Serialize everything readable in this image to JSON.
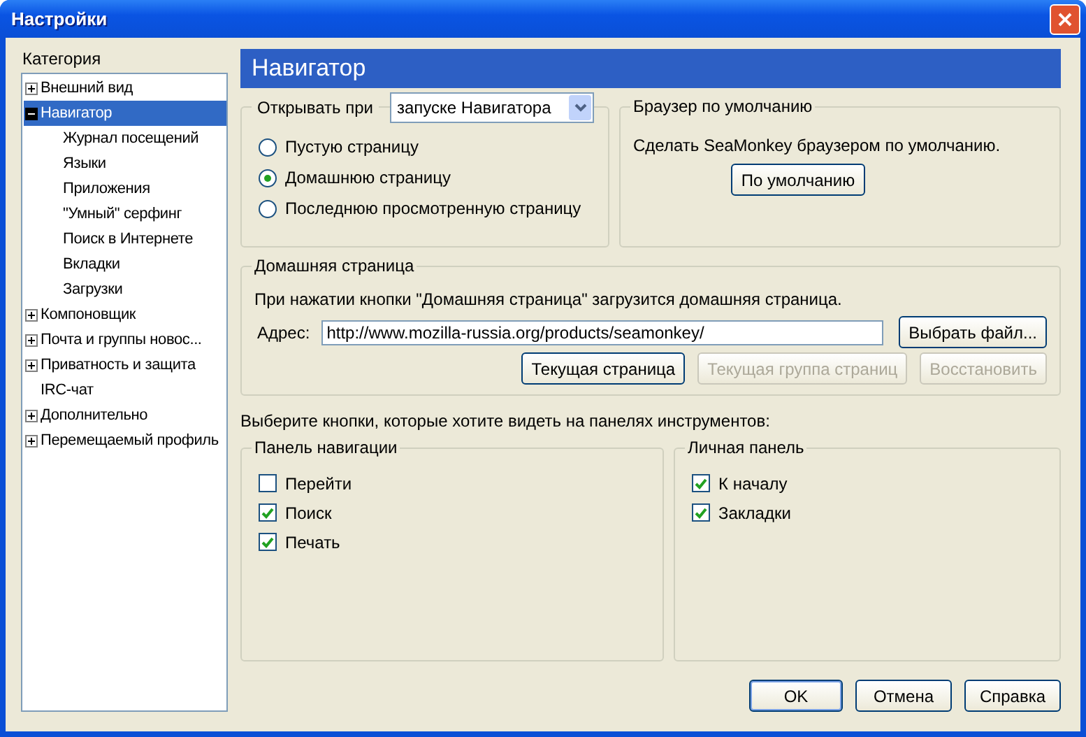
{
  "window": {
    "title": "Настройки"
  },
  "sidebar": {
    "label": "Категория",
    "items": [
      {
        "label": "Внешний вид",
        "selected": false,
        "expanded": false
      },
      {
        "label": "Навигатор",
        "selected": true,
        "expanded": true,
        "children": [
          {
            "label": "Журнал посещений",
            "selected": false
          },
          {
            "label": "Языки",
            "selected": false
          },
          {
            "label": "Приложения",
            "selected": false
          },
          {
            "label": "\"Умный\" серфинг",
            "selected": false
          },
          {
            "label": "Поиск в Интернете",
            "selected": false
          },
          {
            "label": "Вкладки",
            "selected": false
          },
          {
            "label": "Загрузки",
            "selected": false
          }
        ]
      },
      {
        "label": "Компоновщик",
        "selected": false,
        "expanded": false
      },
      {
        "label": "Почта и группы новос...",
        "selected": false,
        "expanded": false
      },
      {
        "label": "Приватность и защита",
        "selected": false,
        "expanded": false
      },
      {
        "label": "IRC-чат",
        "selected": false
      },
      {
        "label": "Дополнительно",
        "selected": false,
        "expanded": false
      },
      {
        "label": "Перемещаемый профиль",
        "selected": false,
        "expanded": false
      }
    ]
  },
  "header": "Навигатор",
  "open_at": {
    "label": "Открывать при",
    "value": "запуске Навигатора",
    "options": [
      {
        "label": "Пустую страницу",
        "selected": false
      },
      {
        "label": "Домашнюю страницу",
        "selected": true
      },
      {
        "label": "Последнюю просмотренную страницу",
        "selected": false
      }
    ]
  },
  "default_browser": {
    "title": "Браузер по умолчанию",
    "text": "Сделать SeaMonkey браузером по умолчанию.",
    "button": "По умолчанию"
  },
  "home_page": {
    "title": "Домашняя страница",
    "text": "При нажатии кнопки \"Домашняя страница\" загрузится домашняя страница.",
    "address_label": "Адрес:",
    "address": "http://www.mozilla-russia.org/products/seamonkey/",
    "browse_button": "Выбрать файл...",
    "buttons": [
      {
        "label": "Текущая страница",
        "disabled": false
      },
      {
        "label": "Текущая группа страниц",
        "disabled": true
      },
      {
        "label": "Восстановить",
        "disabled": true
      }
    ]
  },
  "toolbar_hint": "Выберите кнопки, которые хотите видеть на панелях инструментов:",
  "panels": [
    {
      "title": "Панель навигации",
      "items": [
        {
          "label": "Перейти",
          "checked": false
        },
        {
          "label": "Поиск",
          "checked": true
        },
        {
          "label": "Печать",
          "checked": true
        }
      ]
    },
    {
      "title": "Личная панель",
      "items": [
        {
          "label": "К началу",
          "checked": true
        },
        {
          "label": "Закладки",
          "checked": true
        }
      ]
    }
  ],
  "buttons": [
    {
      "label": "OK",
      "kind": "default"
    },
    {
      "label": "Отмена",
      "kind": "normal"
    },
    {
      "label": "Справка",
      "kind": "normal"
    }
  ]
}
